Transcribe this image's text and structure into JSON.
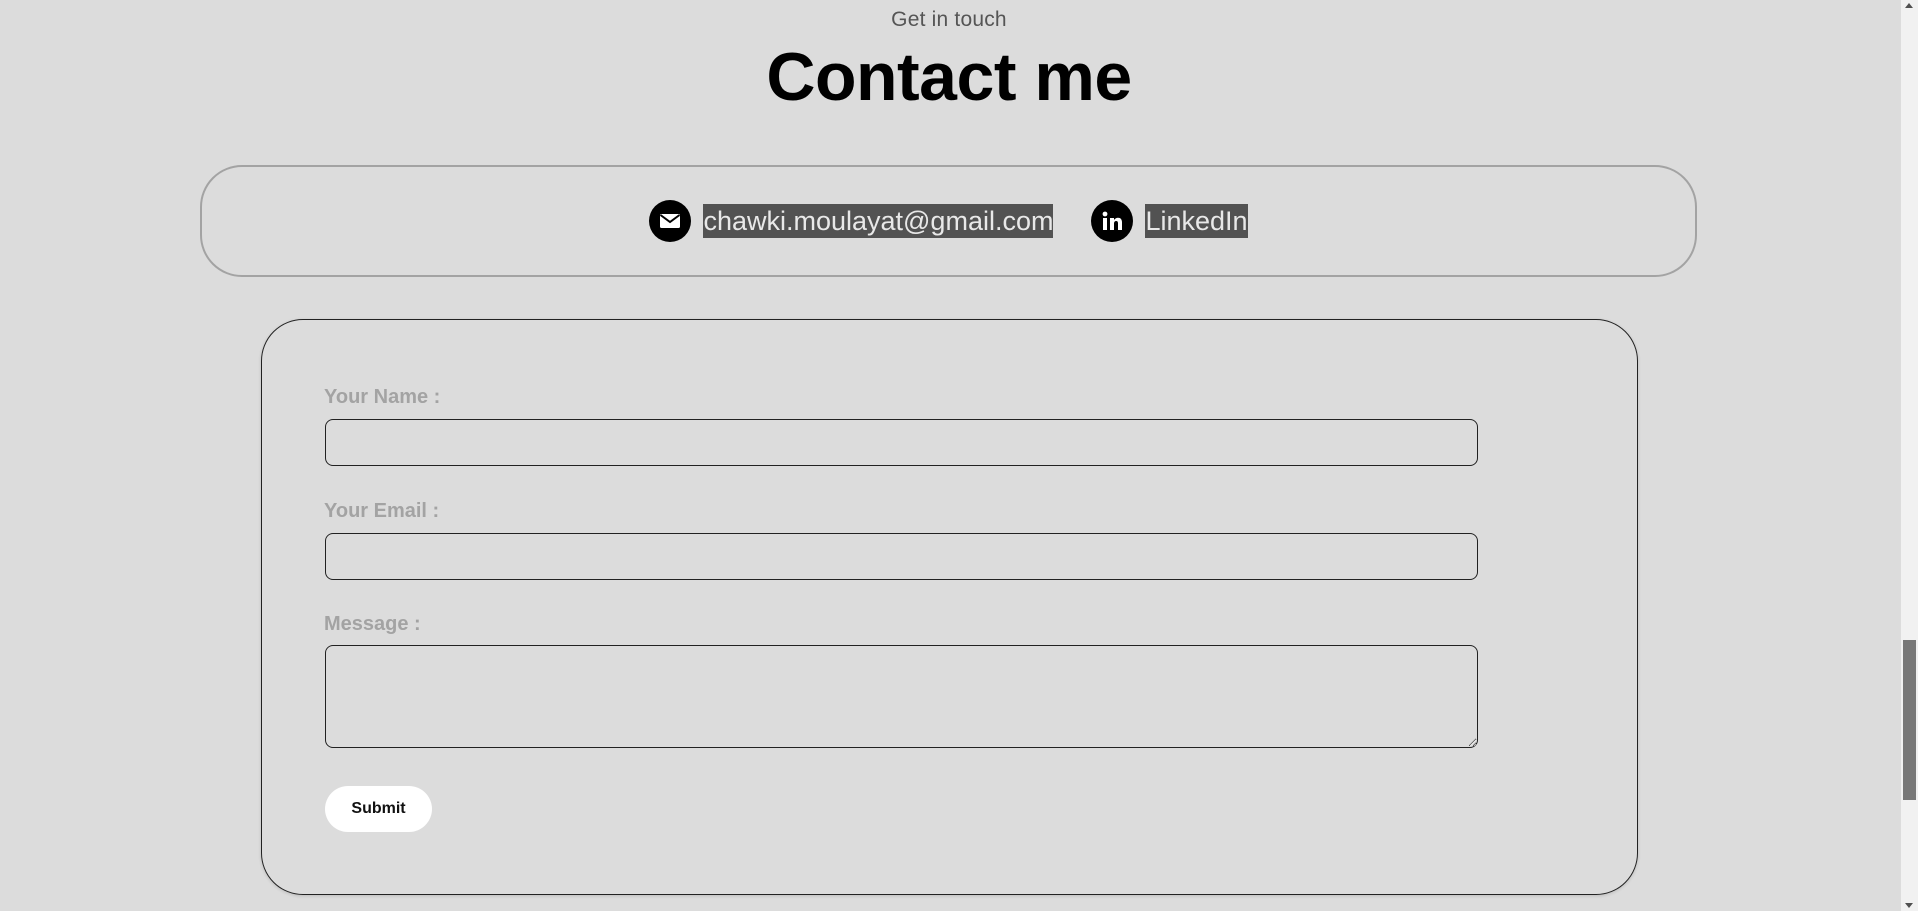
{
  "section": {
    "eyebrow": "Get in touch",
    "title": "Contact me"
  },
  "contacts": [
    {
      "icon": "mail-icon",
      "label": "chawki.moulayat@gmail.com"
    },
    {
      "icon": "linkedin-icon",
      "label": "LinkedIn"
    }
  ],
  "form": {
    "name_label": "Your Name :",
    "name_value": "",
    "email_label": "Your Email :",
    "email_value": "",
    "message_label": "Message :",
    "message_value": "",
    "submit_label": "Submit"
  },
  "colors": {
    "background": "#dcdcdc",
    "text_primary": "#000000",
    "label_muted": "#a3a3a3",
    "highlight_bg": "#525252",
    "button_bg": "#ffffff"
  }
}
